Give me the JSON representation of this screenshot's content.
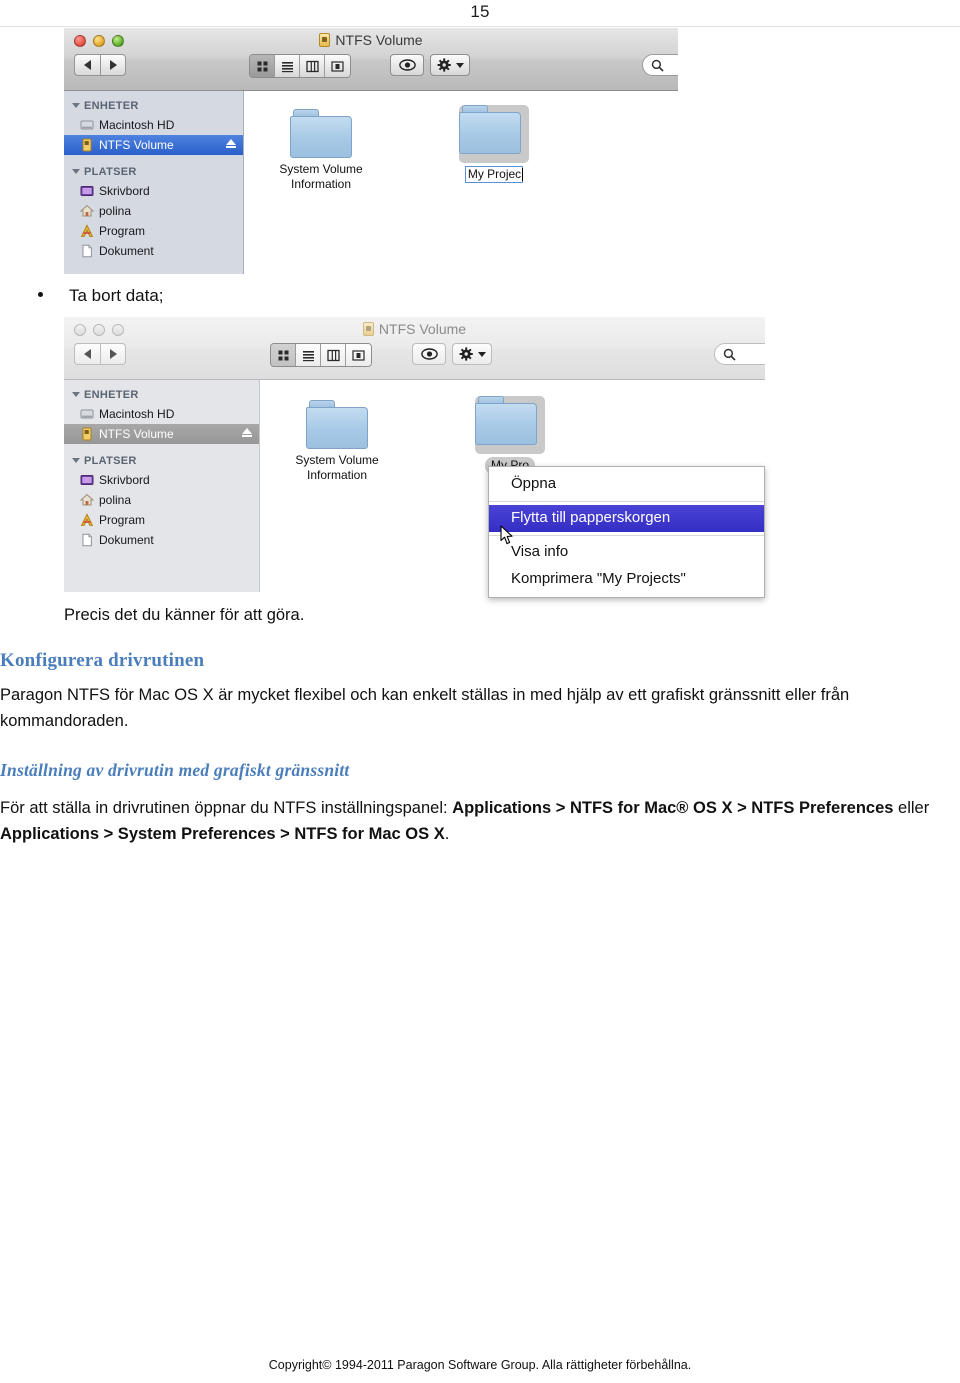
{
  "page": {
    "number": "15",
    "footer": "Copyright© 1994-2011 Paragon Software Group. Alla rättigheter förbehållna."
  },
  "window_top": {
    "title": "NTFS Volume",
    "title_icon": "ntfs-volume-icon",
    "traffic_lights": [
      "close",
      "minimize",
      "zoom"
    ],
    "nav": {
      "back": "back-arrow",
      "forward": "forward-arrow"
    },
    "view_modes": [
      {
        "name": "icon-view",
        "active": true
      },
      {
        "name": "list-view",
        "active": false
      },
      {
        "name": "column-view",
        "active": false
      },
      {
        "name": "coverflow-view",
        "active": false
      }
    ],
    "quicklook_label": "eye-icon",
    "action_label": "gear-icon",
    "search_placeholder": "",
    "sidebar": {
      "groups": [
        {
          "label": "ENHETER",
          "items": [
            {
              "label": "Macintosh HD",
              "icon": "harddisk-icon",
              "selected": false,
              "eject": false
            },
            {
              "label": "NTFS Volume",
              "icon": "ntfs-volume-icon",
              "selected": true,
              "eject": true
            }
          ]
        },
        {
          "label": "PLATSER",
          "items": [
            {
              "label": "Skrivbord",
              "icon": "desktop-icon",
              "selected": false,
              "eject": false
            },
            {
              "label": "polina",
              "icon": "home-icon",
              "selected": false,
              "eject": false
            },
            {
              "label": "Program",
              "icon": "applications-icon",
              "selected": false,
              "eject": false
            },
            {
              "label": "Dokument",
              "icon": "documents-icon",
              "selected": false,
              "eject": false
            }
          ]
        }
      ]
    },
    "files": [
      {
        "label": "System Volume Information",
        "selected": false,
        "renaming": false
      },
      {
        "label": "My Projec",
        "selected": true,
        "renaming": true
      }
    ]
  },
  "window_bottom": {
    "title": "NTFS Volume",
    "title_icon": "ntfs-volume-icon",
    "traffic_lights": [
      "close",
      "minimize",
      "zoom"
    ],
    "nav": {
      "back": "back-arrow",
      "forward": "forward-arrow"
    },
    "view_modes": [
      {
        "name": "icon-view",
        "active": true
      },
      {
        "name": "list-view",
        "active": false
      },
      {
        "name": "column-view",
        "active": false
      },
      {
        "name": "coverflow-view",
        "active": false
      }
    ],
    "quicklook_label": "eye-icon",
    "action_label": "gear-icon",
    "search_placeholder": "",
    "sidebar": {
      "groups": [
        {
          "label": "ENHETER",
          "items": [
            {
              "label": "Macintosh HD",
              "icon": "harddisk-icon",
              "selected": false,
              "eject": false
            },
            {
              "label": "NTFS Volume",
              "icon": "ntfs-volume-icon",
              "selected": true,
              "eject": true
            }
          ]
        },
        {
          "label": "PLATSER",
          "items": [
            {
              "label": "Skrivbord",
              "icon": "desktop-icon",
              "selected": false,
              "eject": false
            },
            {
              "label": "polina",
              "icon": "home-icon",
              "selected": false,
              "eject": false
            },
            {
              "label": "Program",
              "icon": "applications-icon",
              "selected": false,
              "eject": false
            },
            {
              "label": "Dokument",
              "icon": "documents-icon",
              "selected": false,
              "eject": false
            }
          ]
        }
      ]
    },
    "files": [
      {
        "label": "System Volume Information",
        "selected": false,
        "renaming": false
      },
      {
        "label": "My Pro",
        "selected": true,
        "renaming": false
      }
    ],
    "context_menu": {
      "items": [
        {
          "label": "Öppna",
          "highlight": false
        },
        {
          "label": "Flytta till papperskorgen",
          "highlight": true
        },
        {
          "label": "Visa info",
          "highlight": false
        },
        {
          "label": "Komprimera \"My Projects\"",
          "highlight": false
        }
      ]
    }
  },
  "document": {
    "bullet_1": "Ta bort data;",
    "caption_1": "Precis det du känner för att göra.",
    "heading_1": "Konfigurera drivrutinen",
    "paragraph_1_a": "Paragon NTFS för Mac OS X är mycket flexibel och kan enkelt ställas in med hjälp av ett grafiskt gränssnitt eller från",
    "paragraph_1_b": "kommandoraden.",
    "heading_2": "Inställning av drivrutin med grafiskt gränssnitt",
    "paragraph_2_lead": "För att ställa in drivrutinen öppnar du NTFS inställningspanel:",
    "paragraph_2_bold_1": "Applications > NTFS for Mac® OS X > NTFS Preferences",
    "paragraph_2_mid": "eller",
    "paragraph_2_bold_2": "Applications > System Preferences > NTFS for Mac OS X",
    "paragraph_2_end": "."
  },
  "colors": {
    "heading_blue": "#4a7ebb",
    "selection_blue": "#2a5fc9",
    "menu_highlight": "#352ec4",
    "inactive_gray": "#979797"
  }
}
